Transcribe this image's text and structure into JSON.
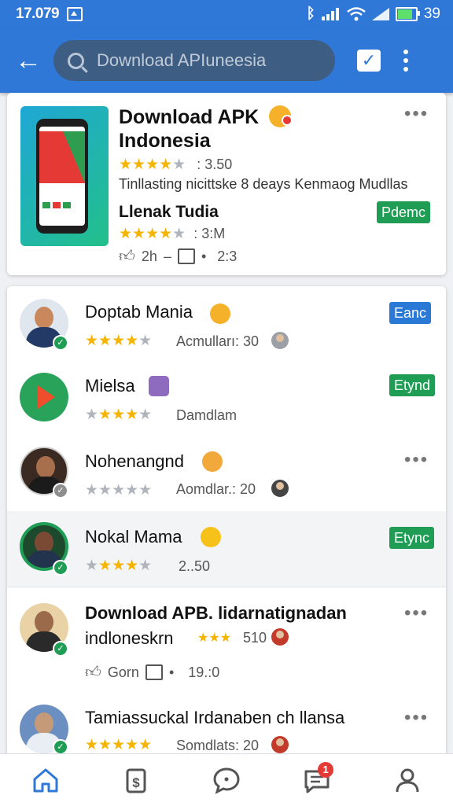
{
  "status_bar": {
    "time": "17.079",
    "battery": "39"
  },
  "app_bar": {
    "search_placeholder": "Download APIuneesia"
  },
  "featured": {
    "title_line1": "Download APK",
    "title_line2": "Indonesia",
    "rating_text": ": 3.50",
    "stars": 4,
    "description": "Tinllasting nicittske 8 deays Kenmaog Mudllas",
    "subtitle": "Llenak Tudia",
    "sub_rating_text": ": 3:M",
    "sub_stars": 4,
    "pill": "Pdemc",
    "footer_likes": "2h",
    "footer_sep": "–",
    "footer_value": "2:3"
  },
  "list": [
    {
      "title": "Doptab Mania",
      "meta": "Acmulları: 30",
      "pill": "Eanc",
      "pill_color": "#2a79d6",
      "stars": 4
    },
    {
      "title": "Mielsa",
      "meta": "Damdlam",
      "pill": "Etynd",
      "pill_color": "#1f9d55",
      "stars": 4
    },
    {
      "title": "Nohenangnd",
      "meta": "Aomdlar.: 20",
      "stars": 0
    },
    {
      "title": "Nokal Mama",
      "meta": "2..50",
      "pill": "Etync",
      "pill_color": "#1f9d55",
      "stars": 4
    },
    {
      "title_line1": "Download APB. lidarnatignadan",
      "title_line2": "indloneskrn",
      "meta": "510",
      "footer_label": "Gorn",
      "footer_value": "19.:0",
      "stars": 3
    },
    {
      "title": "Tamiassuckal Irdanaben ch llansa",
      "meta": "Somdlats: 20",
      "stars": 5
    }
  ],
  "bottom_nav": {
    "messages_badge": "1"
  }
}
